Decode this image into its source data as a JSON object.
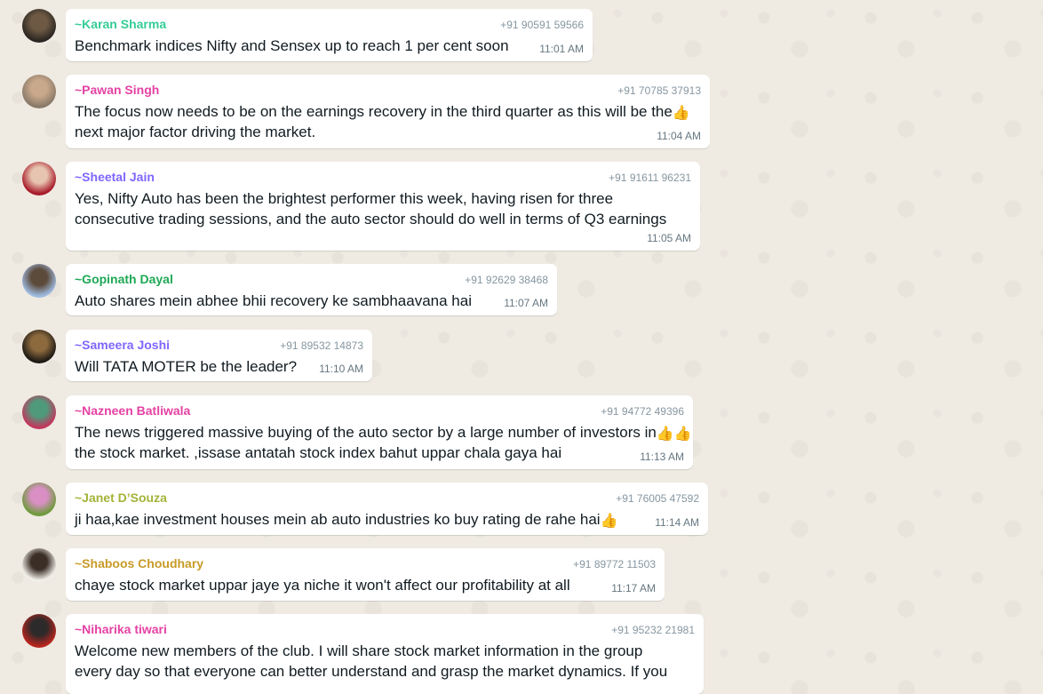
{
  "messages": [
    {
      "sender": "~Karan Sharma",
      "sender_color": "#35cd96",
      "phone": "+91 90591 59566",
      "lines": [
        "Benchmark indices Nifty and Sensex up to reach 1 per cent soon"
      ],
      "time": "11:01 AM",
      "avatar_colors": [
        "#2b2622",
        "#6e5a44"
      ]
    },
    {
      "sender": "~Pawan Singh",
      "sender_color": "#e542a3",
      "phone": "+91 70785 37913",
      "lines": [
        "The focus now needs to be on the earnings recovery in the third quarter as this will be the",
        "next major factor driving the market."
      ],
      "thumbs": [
        0,
        1
      ],
      "time": "11:04 AM",
      "avatar_colors": [
        "#8a7a68",
        "#c9a88b"
      ]
    },
    {
      "sender": "~Sheetal Jain",
      "sender_color": "#7f66ff",
      "phone": "+91 91611 96231",
      "lines": [
        "Yes, Nifty Auto has been the brightest performer this week, having risen for three",
        "consecutive trading sessions, and the auto sector should do well in terms of Q3 earnings"
      ],
      "time": "11:05 AM",
      "avatar_colors": [
        "#a8192a",
        "#e7c4b0"
      ]
    },
    {
      "sender": "~Gopinath Dayal",
      "sender_color": "#1fa855",
      "phone": "+91 92629 38468",
      "lines": [
        "Auto shares  mein abhee bhii recovery ke sambhaavana hai"
      ],
      "time": "11:07 AM",
      "avatar_colors": [
        "#9ebadf",
        "#5c4a3a"
      ]
    },
    {
      "sender": "~Sameera Joshi",
      "sender_color": "#7f66ff",
      "phone": "+91 89532 14873",
      "lines": [
        "Will TATA MOTER be the leader?"
      ],
      "time": "11:10 AM",
      "avatar_colors": [
        "#1e1a14",
        "#8c6a3e"
      ]
    },
    {
      "sender": "~Nazneen Batliwala",
      "sender_color": "#e542a3",
      "phone": "+91 94772 49396",
      "lines": [
        "The news triggered massive buying of the auto sector by a large number of investors in",
        "the stock market. ,issase antatah stock index bahut uppar chala gaya hai"
      ],
      "thumbs": [
        0,
        2
      ],
      "time": "11:13 AM",
      "avatar_colors": [
        "#c2385d",
        "#4f9a7b"
      ]
    },
    {
      "sender": "~Janet D’Souza",
      "sender_color": "#a5b337",
      "phone": "+91 76005 47592",
      "lines": [
        "ji haa,kae investment houses mein ab auto industries ko buy rating de rahe hai"
      ],
      "thumbs": [
        0,
        1
      ],
      "time": "11:14 AM",
      "avatar_colors": [
        "#6e9b3b",
        "#d98fc4"
      ]
    },
    {
      "sender": "~Shaboos Choudhary",
      "sender_color": "#c89b28",
      "phone": "+91 89772 11503",
      "lines": [
        "chaye stock market uppar jaye ya niche it won't affect our profitability at all"
      ],
      "time": "11:17 AM",
      "avatar_colors": [
        "#f1efe9",
        "#3a2e26"
      ]
    },
    {
      "sender": "~Niharika tiwari",
      "sender_color": "#e542a3",
      "phone": "+91 95232 21981",
      "lines": [
        "Welcome new members of the club. I will share stock market information in the group",
        "every day so that everyone can better understand and grasp the market dynamics. If you"
      ],
      "time": "",
      "avatar_colors": [
        "#b7261f",
        "#2c2a2a"
      ]
    }
  ]
}
